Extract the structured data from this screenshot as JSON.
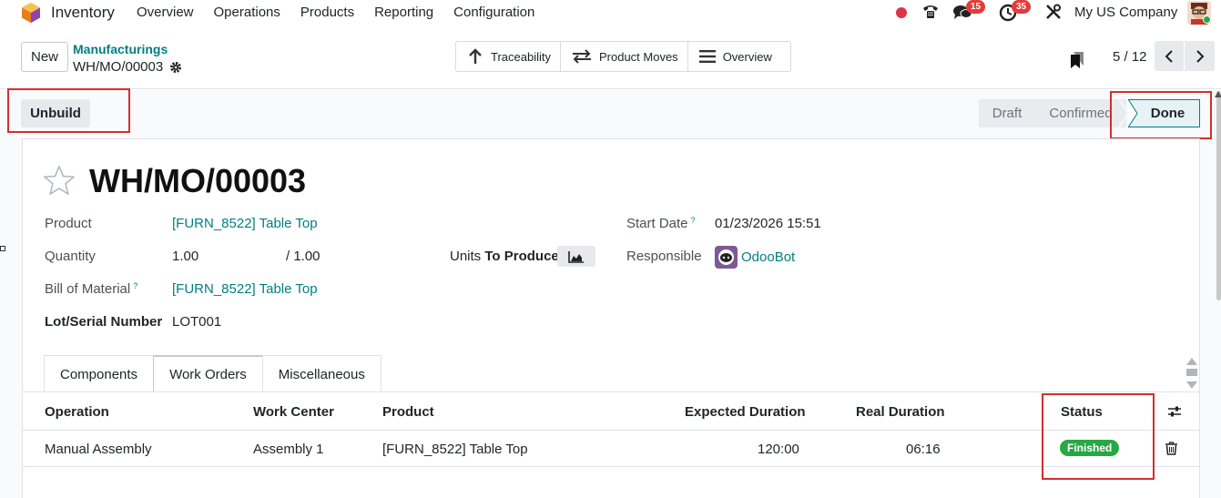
{
  "navbar": {
    "app_name": "Inventory",
    "menu": [
      "Overview",
      "Operations",
      "Products",
      "Reporting",
      "Configuration"
    ],
    "chat_count": "15",
    "activity_count": "35",
    "company": "My US Company"
  },
  "control_panel": {
    "new_label": "New",
    "breadcrumb_parent": "Manufacturings",
    "breadcrumb_current": "WH/MO/00003",
    "smart_buttons": [
      "Traceability",
      "Product Moves",
      "Overview"
    ],
    "pager": "5 / 12"
  },
  "statusbar": {
    "unbuild_label": "Unbuild",
    "stages": [
      "Draft",
      "Confirmed",
      "Done"
    ],
    "current_stage": "Done"
  },
  "form": {
    "title": "WH/MO/00003",
    "product_label": "Product",
    "product_value": "[FURN_8522] Table Top",
    "quantity_label": "Quantity",
    "quantity_value": "1.00",
    "quantity_total": "/ 1.00",
    "units_label_a": "Units",
    "units_label_b": "To Produce",
    "bom_label": "Bill of Material",
    "bom_value": "[FURN_8522] Table Top",
    "lot_label": "Lot/Serial Number",
    "lot_value": "LOT001",
    "start_date_label": "Start Date",
    "start_date_value": "01/23/2026 15:51",
    "responsible_label": "Responsible",
    "responsible_value": "OdooBot",
    "help_mark": "?"
  },
  "tabs": [
    "Components",
    "Work Orders",
    "Miscellaneous"
  ],
  "work_orders": {
    "columns": [
      "Operation",
      "Work Center",
      "Product",
      "Expected Duration",
      "Real Duration",
      "Status"
    ],
    "rows": [
      {
        "operation": "Manual Assembly",
        "work_center": "Assembly 1",
        "product": "[FURN_8522] Table Top",
        "expected_duration": "120:00",
        "real_duration": "06:16",
        "status": "Finished"
      }
    ]
  },
  "colors": {
    "accent": "#017e84",
    "status_finished": "#28a745",
    "badge": "#e33b3b",
    "highlight_box": "#d32f2f"
  }
}
